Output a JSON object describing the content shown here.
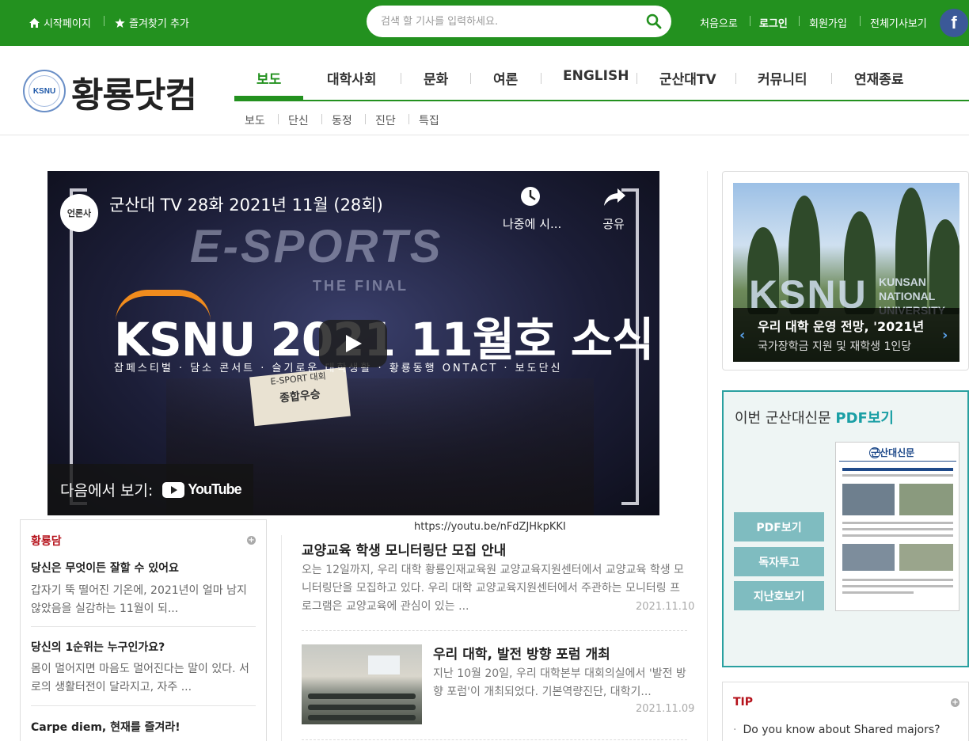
{
  "topbar": {
    "home_label": "시작페이지",
    "favorite_label": "즐겨찾기 추가",
    "search_placeholder": "검색 할 기사를 입력하세요.",
    "links": [
      "처음으로",
      "로그인",
      "회원가입",
      "전체기사보기"
    ],
    "facebook_letter": "f",
    "bar_color": "#23911f"
  },
  "logo": {
    "mark_text": "KSNU",
    "text": "황룡닷컴"
  },
  "gnb": {
    "items": [
      "보도",
      "대학사회",
      "문화",
      "여론",
      "ENGLISH",
      "군산대TV",
      "커뮤니티",
      "연재종료"
    ],
    "active": "보도",
    "sub_items": [
      "보도",
      "단신",
      "동정",
      "진단",
      "특집"
    ]
  },
  "video": {
    "channel": "언론사",
    "title": "군산대 TV 28화 2021년 11월 (28회)",
    "watch_later": "나중에 시...",
    "share": "공유",
    "bg_esports": "E-SPORTS",
    "bg_final": "THE FINAL",
    "headline": "KSNU 2021 11월호 소식",
    "tags": "잡페스티벌 · 담소 콘서트 · 슬기로운 대학생활 · 황룡동행 ONTACT · 보도단신",
    "sign_line1": "E-SPORT 대회",
    "sign_line2": "종합우승",
    "watch_on": "다음에서 보기:",
    "youtube": "YouTube",
    "url": "https://youtu.be/nFdZJHkpKKI"
  },
  "hwangryongdam": {
    "title": "황룡담",
    "items": [
      {
        "title": "당신은 무엇이든 잘할 수 있어요",
        "desc": "갑자기 뚝 떨어진 기온에, 2021년이 얼마 남지 않았음을 실감하는 11월이 되..."
      },
      {
        "title": "당신의 1순위는 누구인가요?",
        "desc": "몸이 멀어지면 마음도 멀어진다는 말이 있다. 서로의 생활터전이 달라지고, 자주 ..."
      },
      {
        "title": "Carpe diem, 현재를 즐겨라!",
        "desc": ""
      }
    ]
  },
  "articles": [
    {
      "title": "교양교육 학생 모니터링단 모집 안내",
      "desc": "오는 12일까지, 우리 대학 황룡인재교육원 교양교육지원센터에서 교양교육 학생 모니터링단을 모집하고 있다. 우리 대학 교양교육지원센터에서 주관하는 모니터링 프로그램은 교양교육에 관심이 있는 ...",
      "date": "2021.11.10"
    },
    {
      "title": "우리 대학, 발전 방향 포럼 개최",
      "desc": "지난 10월 20일, 우리 대학본부 대회의실에서 '발전 방향 포럼'이 개최되었다. 기본역량진단, 대학기...",
      "date": "2021.11.09"
    }
  ],
  "slider": {
    "title": "우리 대학 운영 전망, '2021년",
    "desc": "국가장학금 지원 및 재학생 1인당",
    "logo_text": "KSNU",
    "logo_name_1": "KUNSAN",
    "logo_name_2": "NATIONAL",
    "logo_name_3": "UNIVERSITY"
  },
  "pdf": {
    "heading": "이번 군산대신문",
    "heading_highlight": "PDF보기",
    "buttons": [
      "PDF보기",
      "독자투고",
      "지난호보기"
    ],
    "paper_masthead": "군산대신문"
  },
  "tip": {
    "title": "TIP",
    "items": [
      "Do you know about Shared majors?"
    ]
  }
}
